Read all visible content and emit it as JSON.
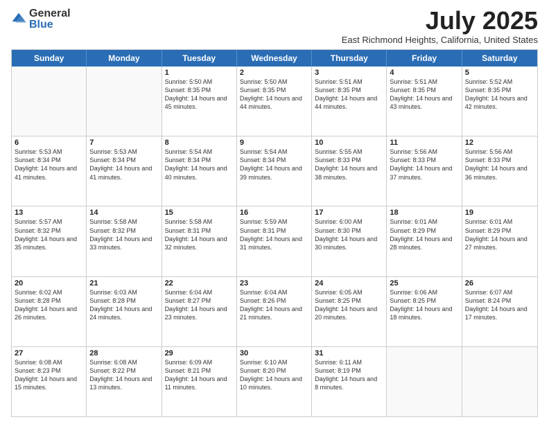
{
  "logo": {
    "general": "General",
    "blue": "Blue"
  },
  "header": {
    "month": "July 2025",
    "location": "East Richmond Heights, California, United States"
  },
  "days": [
    "Sunday",
    "Monday",
    "Tuesday",
    "Wednesday",
    "Thursday",
    "Friday",
    "Saturday"
  ],
  "weeks": [
    [
      {
        "day": "",
        "empty": true
      },
      {
        "day": "",
        "empty": true
      },
      {
        "day": "1",
        "rise": "5:50 AM",
        "set": "8:35 PM",
        "daylight": "14 hours and 45 minutes."
      },
      {
        "day": "2",
        "rise": "5:50 AM",
        "set": "8:35 PM",
        "daylight": "14 hours and 44 minutes."
      },
      {
        "day": "3",
        "rise": "5:51 AM",
        "set": "8:35 PM",
        "daylight": "14 hours and 44 minutes."
      },
      {
        "day": "4",
        "rise": "5:51 AM",
        "set": "8:35 PM",
        "daylight": "14 hours and 43 minutes."
      },
      {
        "day": "5",
        "rise": "5:52 AM",
        "set": "8:35 PM",
        "daylight": "14 hours and 42 minutes."
      }
    ],
    [
      {
        "day": "6",
        "rise": "5:53 AM",
        "set": "8:34 PM",
        "daylight": "14 hours and 41 minutes."
      },
      {
        "day": "7",
        "rise": "5:53 AM",
        "set": "8:34 PM",
        "daylight": "14 hours and 41 minutes."
      },
      {
        "day": "8",
        "rise": "5:54 AM",
        "set": "8:34 PM",
        "daylight": "14 hours and 40 minutes."
      },
      {
        "day": "9",
        "rise": "5:54 AM",
        "set": "8:34 PM",
        "daylight": "14 hours and 39 minutes."
      },
      {
        "day": "10",
        "rise": "5:55 AM",
        "set": "8:33 PM",
        "daylight": "14 hours and 38 minutes."
      },
      {
        "day": "11",
        "rise": "5:56 AM",
        "set": "8:33 PM",
        "daylight": "14 hours and 37 minutes."
      },
      {
        "day": "12",
        "rise": "5:56 AM",
        "set": "8:33 PM",
        "daylight": "14 hours and 36 minutes."
      }
    ],
    [
      {
        "day": "13",
        "rise": "5:57 AM",
        "set": "8:32 PM",
        "daylight": "14 hours and 35 minutes."
      },
      {
        "day": "14",
        "rise": "5:58 AM",
        "set": "8:32 PM",
        "daylight": "14 hours and 33 minutes."
      },
      {
        "day": "15",
        "rise": "5:58 AM",
        "set": "8:31 PM",
        "daylight": "14 hours and 32 minutes."
      },
      {
        "day": "16",
        "rise": "5:59 AM",
        "set": "8:31 PM",
        "daylight": "14 hours and 31 minutes."
      },
      {
        "day": "17",
        "rise": "6:00 AM",
        "set": "8:30 PM",
        "daylight": "14 hours and 30 minutes."
      },
      {
        "day": "18",
        "rise": "6:01 AM",
        "set": "8:29 PM",
        "daylight": "14 hours and 28 minutes."
      },
      {
        "day": "19",
        "rise": "6:01 AM",
        "set": "8:29 PM",
        "daylight": "14 hours and 27 minutes."
      }
    ],
    [
      {
        "day": "20",
        "rise": "6:02 AM",
        "set": "8:28 PM",
        "daylight": "14 hours and 26 minutes."
      },
      {
        "day": "21",
        "rise": "6:03 AM",
        "set": "8:28 PM",
        "daylight": "14 hours and 24 minutes."
      },
      {
        "day": "22",
        "rise": "6:04 AM",
        "set": "8:27 PM",
        "daylight": "14 hours and 23 minutes."
      },
      {
        "day": "23",
        "rise": "6:04 AM",
        "set": "8:26 PM",
        "daylight": "14 hours and 21 minutes."
      },
      {
        "day": "24",
        "rise": "6:05 AM",
        "set": "8:25 PM",
        "daylight": "14 hours and 20 minutes."
      },
      {
        "day": "25",
        "rise": "6:06 AM",
        "set": "8:25 PM",
        "daylight": "14 hours and 18 minutes."
      },
      {
        "day": "26",
        "rise": "6:07 AM",
        "set": "8:24 PM",
        "daylight": "14 hours and 17 minutes."
      }
    ],
    [
      {
        "day": "27",
        "rise": "6:08 AM",
        "set": "8:23 PM",
        "daylight": "14 hours and 15 minutes."
      },
      {
        "day": "28",
        "rise": "6:08 AM",
        "set": "8:22 PM",
        "daylight": "14 hours and 13 minutes."
      },
      {
        "day": "29",
        "rise": "6:09 AM",
        "set": "8:21 PM",
        "daylight": "14 hours and 11 minutes."
      },
      {
        "day": "30",
        "rise": "6:10 AM",
        "set": "8:20 PM",
        "daylight": "14 hours and 10 minutes."
      },
      {
        "day": "31",
        "rise": "6:11 AM",
        "set": "8:19 PM",
        "daylight": "14 hours and 8 minutes."
      },
      {
        "day": "",
        "empty": true
      },
      {
        "day": "",
        "empty": true
      }
    ]
  ],
  "labels": {
    "sunrise": "Sunrise:",
    "sunset": "Sunset:",
    "daylight": "Daylight:"
  }
}
